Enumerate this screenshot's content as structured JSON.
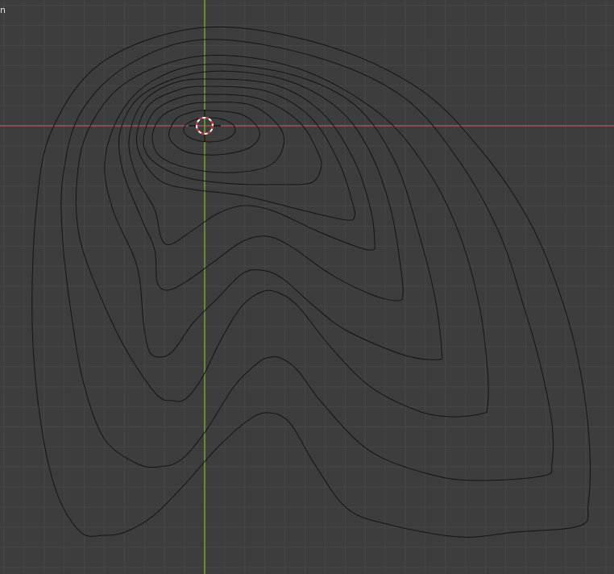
{
  "viewport": {
    "corner_label": "n",
    "colors": {
      "background": "#3d3d3d",
      "grid": "#474747",
      "x_axis": "#a0525c",
      "y_axis": "#7aa13a",
      "contour": "#141414",
      "cursor_red": "#c03030",
      "cursor_white": "#ffffff"
    },
    "contour_count": 11,
    "icons": [
      "3d-cursor-icon"
    ]
  }
}
